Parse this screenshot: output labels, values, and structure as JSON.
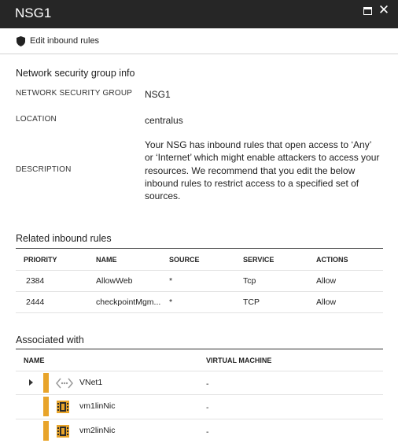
{
  "window": {
    "title": "NSG1"
  },
  "command": {
    "edit_label": "Edit inbound rules"
  },
  "info": {
    "heading": "Network security group info",
    "nsg_label": "NETWORK SECURITY GROUP",
    "nsg_value": "NSG1",
    "location_label": "LOCATION",
    "location_value": "centralus",
    "description_label": "DESCRIPTION",
    "description_value": "Your NSG has inbound rules that open access to ‘Any’ or ‘Internet’ which might enable attackers to access your resources. We recommend that you edit the below inbound rules to restrict access to a specified set of sources."
  },
  "rules": {
    "heading": "Related inbound rules",
    "columns": [
      "PRIORITY",
      "NAME",
      "SOURCE",
      "SERVICE",
      "ACTIONS"
    ],
    "rows": [
      [
        "2384",
        "AllowWeb",
        "*",
        "Tcp",
        "Allow"
      ],
      [
        "2444",
        "checkpointMgm...",
        "*",
        "TCP",
        "Allow"
      ]
    ]
  },
  "associated": {
    "heading": "Associated with",
    "columns": [
      "NAME",
      "VIRTUAL MACHINE"
    ],
    "rows": [
      {
        "name": "VNet1",
        "vm": "-",
        "icon": "vnet-icon",
        "expandable": true
      },
      {
        "name": "vm1linNic",
        "vm": "-",
        "icon": "network-interface-icon",
        "expandable": false
      },
      {
        "name": "vm2linNic",
        "vm": "-",
        "icon": "network-interface-icon",
        "expandable": false
      }
    ]
  },
  "colors": {
    "titlebar": "#262626",
    "accent_bar": "#e8a42a"
  }
}
